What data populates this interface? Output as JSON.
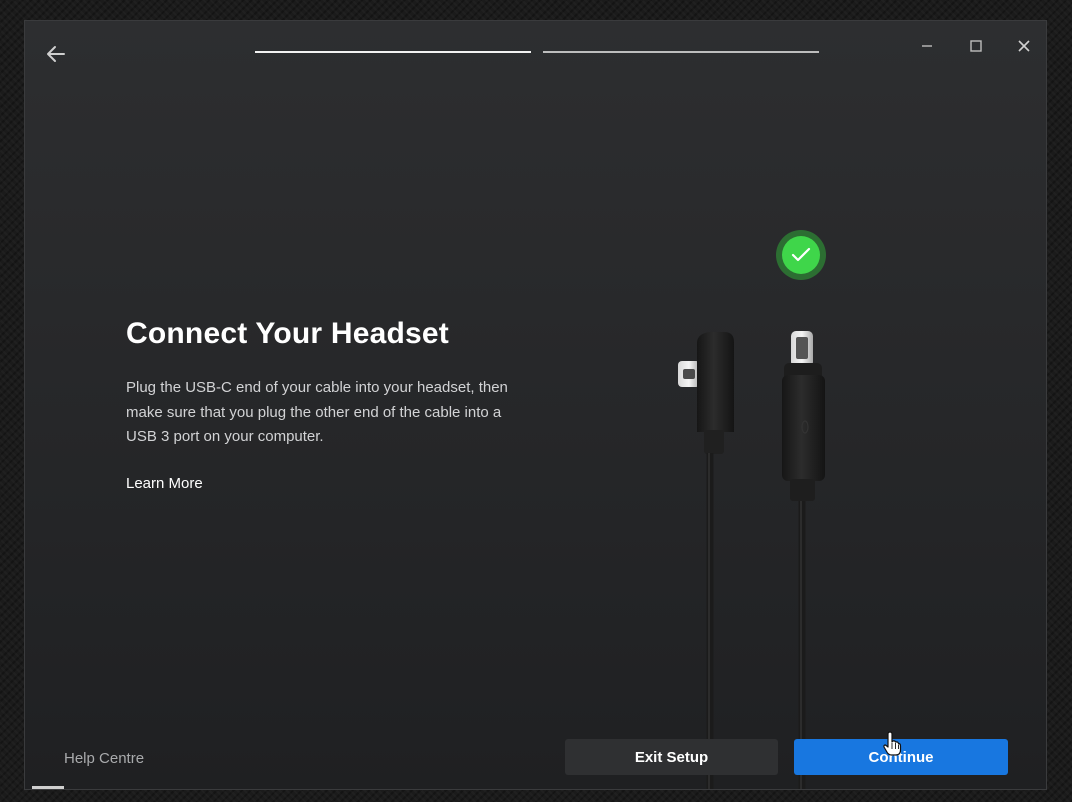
{
  "window": {
    "controls": {
      "minimize_icon": "minimize-icon",
      "maximize_icon": "maximize-icon",
      "close_icon": "close-icon"
    },
    "progress": {
      "steps_total": 2,
      "current_step": 1
    }
  },
  "content": {
    "title": "Connect Your Headset",
    "description": "Plug the USB-C end of your cable into your headset, then make sure that you plug the other end of the cable into a USB 3 port on your computer.",
    "learn_more": "Learn More",
    "status_icon": "check-circle-icon"
  },
  "footer": {
    "help": "Help Centre",
    "exit_button": "Exit Setup",
    "continue_button": "Continue"
  },
  "colors": {
    "accent": "#1877e0",
    "success": "#3fd64a",
    "window_bg": "#2b2c2e"
  }
}
